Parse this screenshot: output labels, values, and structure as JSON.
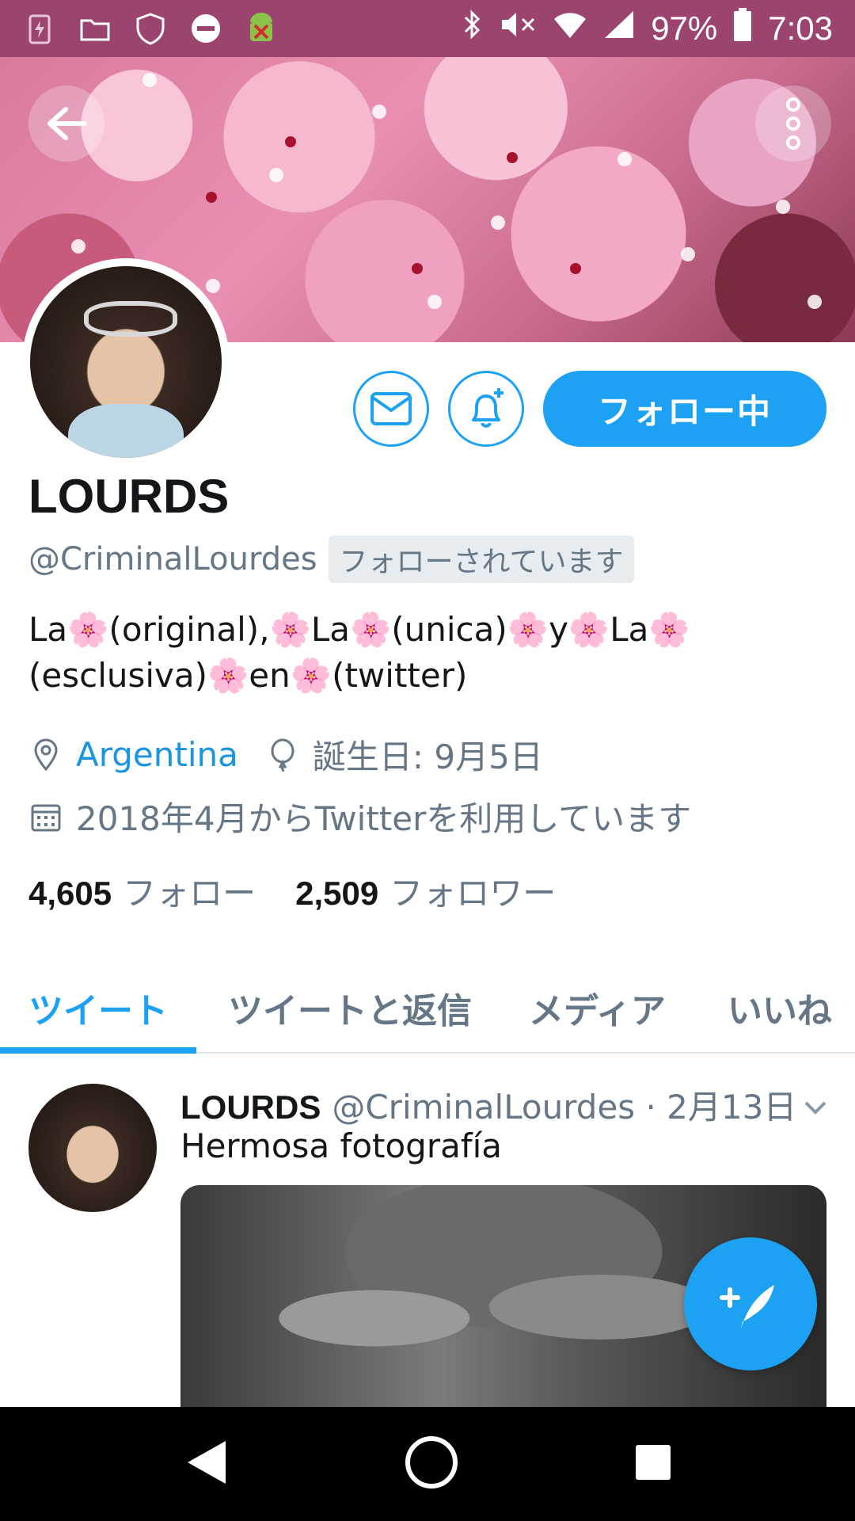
{
  "status_bar": {
    "battery_percent": "97%",
    "time": "7:03"
  },
  "profile": {
    "name": "LOURDS",
    "handle": "@CriminalLourdes",
    "follows_you_badge": "フォローされています",
    "follow_button_label": "フォロー中",
    "bio_line1": "La🌸(original),🌸La🌸(unica)🌸y🌸La🌸",
    "bio_line2": "(esclusiva)🌸en🌸(twitter)",
    "location": "Argentina",
    "birthday": "誕生日: 9月5日",
    "joined": "2018年4月からTwitterを利用しています",
    "following_count": "4,605",
    "following_label": "フォロー",
    "followers_count": "2,509",
    "followers_label": "フォロワー"
  },
  "tabs": [
    {
      "label": "ツイート",
      "active": true
    },
    {
      "label": "ツイートと返信",
      "active": false
    },
    {
      "label": "メディア",
      "active": false
    },
    {
      "label": "いいね",
      "active": false
    }
  ],
  "tweet": {
    "name": "LOURDS",
    "handle_date": "@CriminalLourdes · 2月13日",
    "text": "Hermosa fotografía"
  },
  "colors": {
    "status_bar": "#9c4470",
    "accent": "#1da1f2",
    "secondary_text": "#657786"
  },
  "icons": {
    "back": "arrow-left-icon",
    "more": "more-vertical-icon",
    "message": "envelope-icon",
    "notify": "bell-plus-icon",
    "location": "map-pin-icon",
    "birthday": "balloon-icon",
    "joined": "calendar-icon",
    "compose": "feather-plus-icon"
  }
}
